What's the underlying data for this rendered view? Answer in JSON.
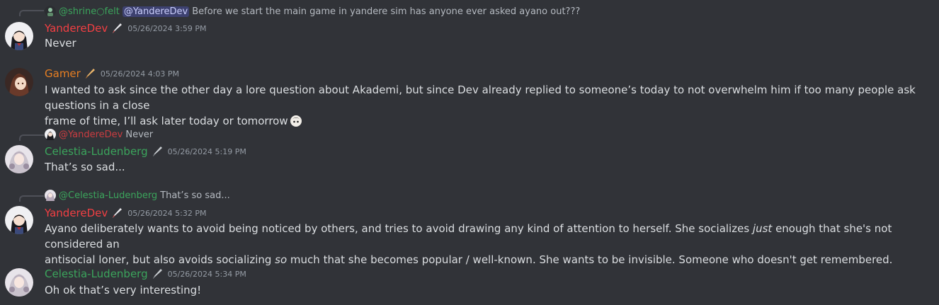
{
  "messages": [
    {
      "reply": {
        "author": "@shrine○felt",
        "mention": "@YandereDev",
        "text": "Before we start the main game in yandere sim has anyone ever asked ayano out???"
      },
      "author": "YandereDev",
      "author_color": "#f23f43",
      "timestamp": "05/26/2024 3:59 PM",
      "content": "Never"
    },
    {
      "author": "Gamer",
      "author_color": "#e67e22",
      "timestamp": "05/26/2024 4:03 PM",
      "content_line1": "I wanted to ask since the other day a lore question about Akademi, but since Dev already replied to someone’s today to not overwhelm him if too many people ask questions in a close",
      "content_line2": "frame of time, I’ll ask later today or tomorrow"
    },
    {
      "reply": {
        "author": "@YandereDev",
        "text": "Never"
      },
      "author": "Celestia-Ludenberg",
      "author_color": "#3ba55c",
      "timestamp": "05/26/2024 5:19 PM",
      "content": "That’s so sad..."
    },
    {
      "reply": {
        "author": "@Celestia-Ludenberg",
        "text": "That’s so sad..."
      },
      "author": "YandereDev",
      "author_color": "#f23f43",
      "timestamp": "05/26/2024 5:32 PM",
      "content_parts": {
        "p1": "Ayano deliberately wants to avoid being noticed by others, and tries to avoid drawing any kind of attention to herself. She socializes ",
        "em1": "just",
        "p2": " enough that she's not considered an",
        "p3": "antisocial loner, but also avoids socializing ",
        "em2": "so",
        "p4": " much that she becomes popular / well-known. She wants to be invisible. Someone who doesn't get remembered."
      }
    },
    {
      "author": "Celestia-Ludenberg",
      "author_color": "#3ba55c",
      "timestamp": "05/26/2024 5:34 PM",
      "content": "Oh ok that’s very interesting!"
    }
  ]
}
